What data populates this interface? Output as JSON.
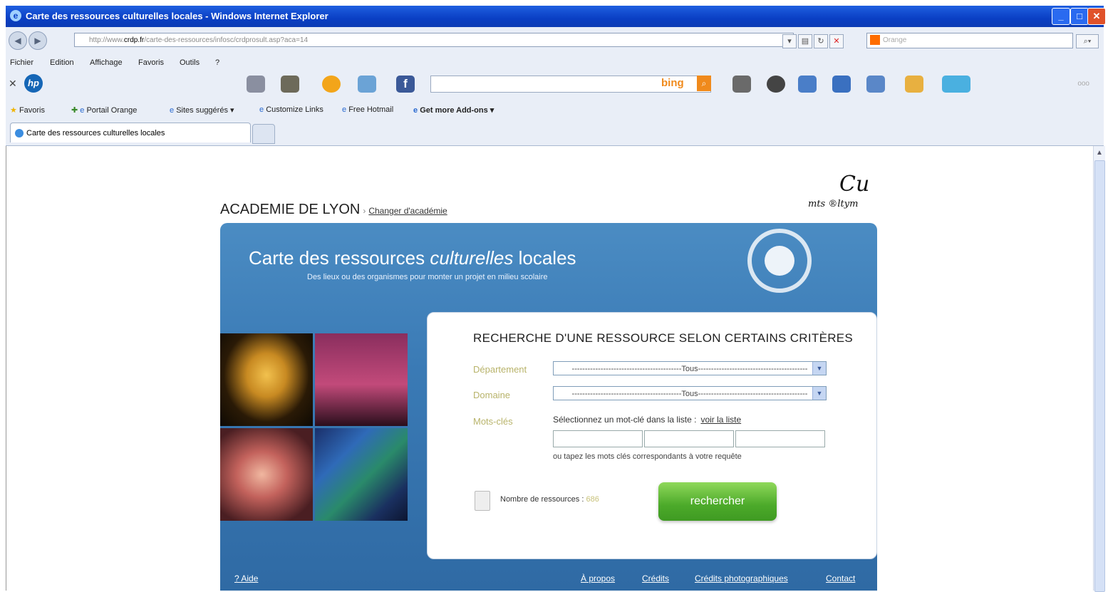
{
  "window": {
    "title": "Carte des ressources culturelles locales - Windows Internet Explorer"
  },
  "address": {
    "url_prefix": "http://www.",
    "url_domain": "crdp.fr",
    "url_rest": "/carte-des-ressources/infosc/crdprosult.asp?aca=14",
    "search_engine": "Orange"
  },
  "menu": {
    "items": [
      "Fichier",
      "Edition",
      "Affichage",
      "Favoris",
      "Outils",
      "?"
    ]
  },
  "toolbar": {
    "bing_label": "bing"
  },
  "favorites": {
    "items": [
      "Favoris",
      "Portail Orange",
      "Sites suggérés ▾",
      "Customize Links",
      "Free Hotmail",
      "Get more Add-ons ▾"
    ]
  },
  "tab": {
    "label": "Carte des ressources culturelles locales"
  },
  "page": {
    "academy": "ACADEMIE DE LYON",
    "change_link": "Changer d'académie",
    "logo_big": "Cu",
    "logo_small": "mts ®ltym",
    "banner_title_a": "Carte des ressources ",
    "banner_title_b": "culturelles",
    "banner_title_c": " locales",
    "banner_subtitle": "Des lieux ou des organismes pour monter un projet en milieu scolaire",
    "form_title": "RECHERCHE D'UNE RESSOURCE SELON CERTAINS CRITÈRES",
    "label_departement": "Département",
    "label_domaine": "Domaine",
    "label_mots": "Mots-clés",
    "select_departement": "------------------------------------------Tous------------------------------------------",
    "select_domaine": "------------------------------------------Tous------------------------------------------",
    "hint": "Sélectionnez un mot-clé dans la liste :",
    "hint_link": "voir la liste",
    "hint2": "ou tapez les mots clés correspondants à votre requête",
    "count_label": "Nombre de ressources :",
    "count_value": "686",
    "search_button": "rechercher",
    "footer": {
      "aide": "? Aide",
      "apropos": "À propos",
      "credits": "Crédits",
      "credits_photo": "Crédits photographiques",
      "contact": "Contact"
    }
  }
}
